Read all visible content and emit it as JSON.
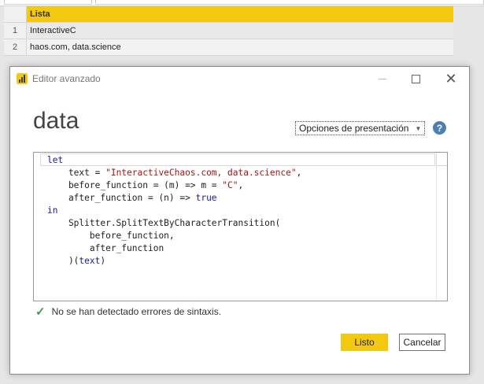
{
  "table": {
    "header": "Lista",
    "rows": [
      {
        "index": "1",
        "value": "InteractiveC"
      },
      {
        "index": "2",
        "value": "haos.com, data.science"
      }
    ]
  },
  "dialog": {
    "title": "Editor avanzado",
    "query_name": "data",
    "display_options_label": "Opciones de presentación",
    "help_label": "?",
    "status_text": "No se han detectado errores de sintaxis.",
    "done_label": "Listo",
    "cancel_label": "Cancelar",
    "code": {
      "l1_kw": "let",
      "l2_a": "    text = ",
      "l2_str": "\"InteractiveChaos.com, data.science\"",
      "l2_b": ",",
      "l3_a": "    before_function = (m) => m = ",
      "l3_str": "\"C\"",
      "l3_b": ",",
      "l4_a": "    after_function = (n) => ",
      "l4_kw": "true",
      "l5_kw": "in",
      "l6": "    Splitter.SplitTextByCharacterTransition(",
      "l7": "        before_function,",
      "l8": "        after_function",
      "l9_a": "    )(",
      "l9_kw": "text",
      "l9_b": ")"
    }
  },
  "colors": {
    "accent": "#f2c811",
    "keyword": "#1a1aa6",
    "string": "#a31515",
    "success": "#3d9a5b",
    "help": "#4f7fb0"
  }
}
